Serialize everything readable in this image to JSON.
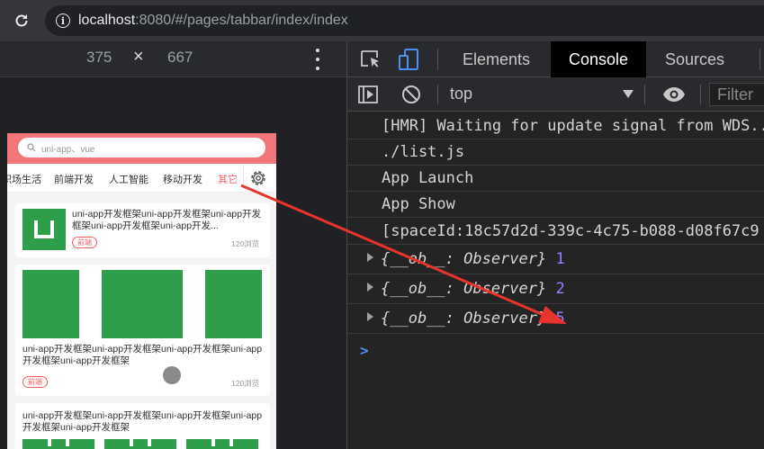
{
  "browser": {
    "url_host": "localhost",
    "url_rest": ":8080/#/pages/tabbar/index/index"
  },
  "device_toolbar": {
    "width": "375",
    "times": "×",
    "height": "667"
  },
  "phone": {
    "search_placeholder": "uni-app、vue",
    "tabs": [
      "职场生活",
      "前端开发",
      "人工智能",
      "移动开发",
      "其它"
    ],
    "card1": {
      "title": "uni-app开发框架uni-app开发框架uni-app开发框架uni-app开发框架uni-app开发...",
      "tag": "前端",
      "views": "120浏览"
    },
    "card2": {
      "title": "uni-app开发框架uni-app开发框架uni-app开发框架uni-app开发框架uni-app开发框架",
      "tag": "前端",
      "views": "120浏览"
    },
    "card3": {
      "title": "uni-app开发框架uni-app开发框架uni-app开发框架uni-app开发框架uni-app开发框架"
    }
  },
  "devtools": {
    "tabs": [
      "Elements",
      "Console",
      "Sources"
    ],
    "context": "top",
    "filter_placeholder": "Filter",
    "console_lines": [
      "[HMR] Waiting for update signal from WDS...",
      "./list.js",
      "App Launch",
      "App Show",
      "[spaceId:18c57d2d-339c-4c75-b088-d08f67c9"
    ],
    "objects": [
      {
        "text": "{__ob__: Observer}",
        "value": "1"
      },
      {
        "text": "{__ob__: Observer}",
        "value": "2"
      },
      {
        "text": "{__ob__: Observer}",
        "value": "5"
      }
    ],
    "prompt": ">"
  },
  "colors": {
    "header_pink": "#f0767a",
    "active_tab_red": "#f25d5d",
    "image_green": "#2f9e4a",
    "annotation_red": "#e8342c",
    "console_number": "#9980ff"
  }
}
